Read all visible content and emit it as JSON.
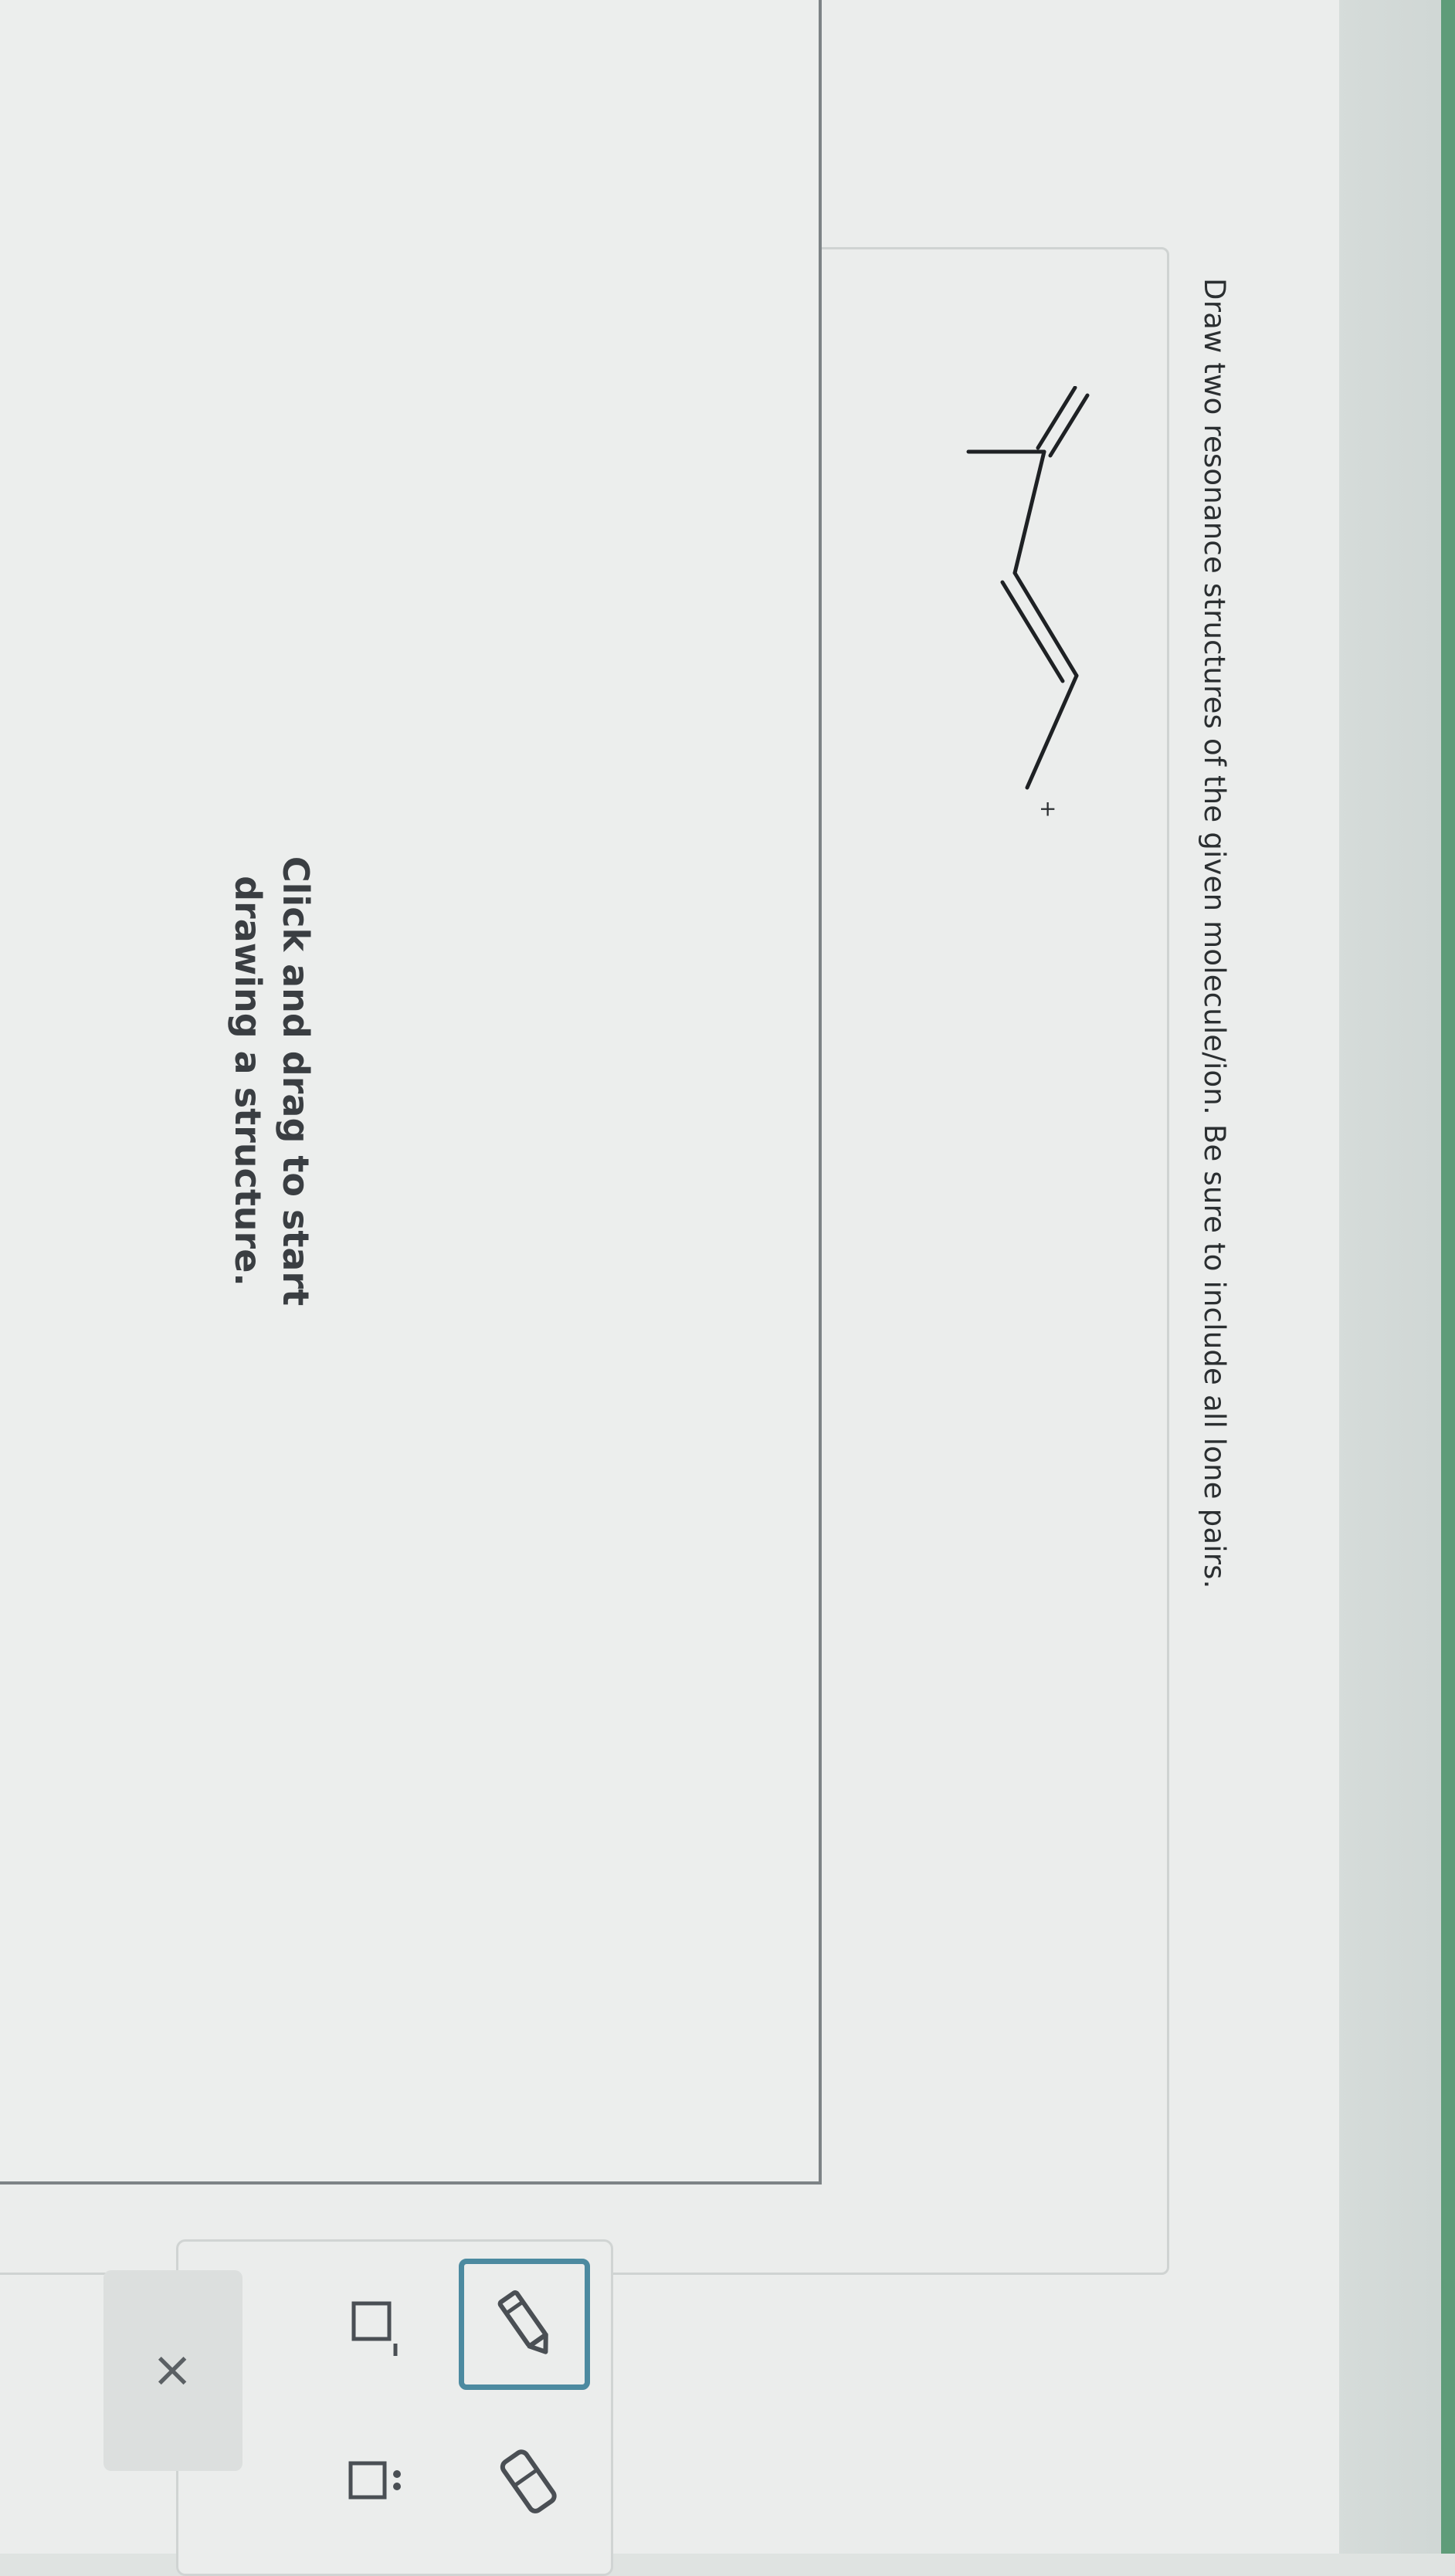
{
  "question": {
    "text": "Draw two resonance structures of the given molecule/ion. Be sure to include all lone pairs."
  },
  "molecule": {
    "charge_label": "+"
  },
  "canvas": {
    "hint": "Click and drag to start drawing a structure."
  },
  "toolbar": {
    "tools": [
      {
        "name": "pencil",
        "icon": "pencil-icon",
        "selected": true
      },
      {
        "name": "eraser",
        "icon": "eraser-icon",
        "selected": false
      },
      {
        "name": "charge",
        "icon": "charge-icon",
        "selected": false
      },
      {
        "name": "lone-pair",
        "icon": "lone-pair-icon",
        "selected": false
      }
    ],
    "clear_label": "×"
  },
  "colors": {
    "accent": "#4c8aa0",
    "header_green": "#5f9c79"
  }
}
